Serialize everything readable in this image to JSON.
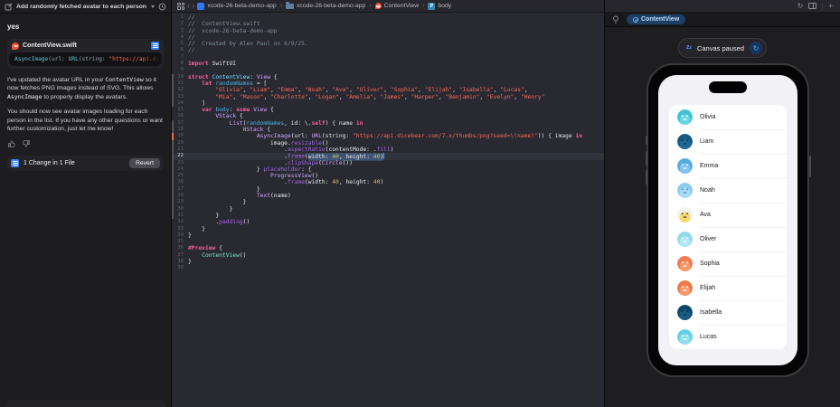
{
  "chat": {
    "header": {
      "title": "Add randomly fetched avatar to each person in ContentVi...",
      "compose_icon": "new-chat",
      "history_icon": "history"
    },
    "user_message": "yes",
    "file_reference": {
      "filename": "ContentView.swift",
      "snippet_segs": [
        [
          "t2",
          "AsyncImage"
        ],
        [
          "t3",
          "(url: "
        ],
        [
          "t2",
          "URL"
        ],
        [
          "t3",
          "(string: "
        ],
        [
          "s2",
          "\"https://api.diceb"
        ]
      ]
    },
    "paragraphs": [
      {
        "segs": [
          [
            "t",
            "I've updated the avatar URL in your "
          ],
          [
            "c",
            "ContentView"
          ],
          [
            "t",
            " so it now fetches PNG images instead of SVG. This allows "
          ],
          [
            "c",
            "AsyncImage"
          ],
          [
            "t",
            " to properly display the avatars."
          ]
        ]
      },
      {
        "segs": [
          [
            "t",
            "You should now see avatar images loading for each person in the list. If you have any other questions or want further customization, just let me know!"
          ]
        ]
      }
    ],
    "changes_bar": {
      "label": "1 Change in 1 File",
      "revert_label": "Revert"
    }
  },
  "editor": {
    "breadcrumbs": [
      {
        "icon": "app",
        "label": "xcode-26-beta-demo-app"
      },
      {
        "icon": "folder",
        "label": "xcode-26-beta-demo-app"
      },
      {
        "icon": "swift",
        "label": "ContentView"
      },
      {
        "icon": "property",
        "label": "body"
      }
    ],
    "code": {
      "lines": [
        {
          "n": 1,
          "s": [
            [
              "cm",
              "//"
            ]
          ]
        },
        {
          "n": 2,
          "s": [
            [
              "cm",
              "//  ContentView.swift"
            ]
          ]
        },
        {
          "n": 3,
          "s": [
            [
              "cm",
              "//  xcode-26-beta-demo-app"
            ]
          ]
        },
        {
          "n": 4,
          "s": [
            [
              "cm",
              "//"
            ]
          ]
        },
        {
          "n": 5,
          "s": [
            [
              "cm",
              "//  Created by Alex Paul on 6/9/25."
            ]
          ]
        },
        {
          "n": 6,
          "s": [
            [
              "cm",
              "//"
            ]
          ]
        },
        {
          "n": 7,
          "s": []
        },
        {
          "n": 8,
          "s": [
            [
              "kw",
              "import"
            ],
            [
              "pl",
              " SwiftUI"
            ]
          ]
        },
        {
          "n": 9,
          "s": []
        },
        {
          "n": 10,
          "chg": "g",
          "s": [
            [
              "kw",
              "struct"
            ],
            [
              "pl",
              " "
            ],
            [
              "pt",
              "ContentView"
            ],
            [
              "pl",
              ": "
            ],
            [
              "ty",
              "View"
            ],
            [
              "pl",
              " {"
            ]
          ]
        },
        {
          "n": 11,
          "chg": "g",
          "s": [
            [
              "pl",
              "    "
            ],
            [
              "kw",
              "let"
            ],
            [
              "pl",
              " "
            ],
            [
              "pv",
              "randomNames"
            ],
            [
              "pl",
              " = ["
            ]
          ]
        },
        {
          "n": 12,
          "chg": "g",
          "s": [
            [
              "pl",
              "        "
            ],
            [
              "st",
              "\"Olivia\""
            ],
            [
              "pl",
              ", "
            ],
            [
              "st",
              "\"Liam\""
            ],
            [
              "pl",
              ", "
            ],
            [
              "st",
              "\"Emma\""
            ],
            [
              "pl",
              ", "
            ],
            [
              "st",
              "\"Noah\""
            ],
            [
              "pl",
              ", "
            ],
            [
              "st",
              "\"Ava\""
            ],
            [
              "pl",
              ", "
            ],
            [
              "st",
              "\"Oliver\""
            ],
            [
              "pl",
              ", "
            ],
            [
              "st",
              "\"Sophia\""
            ],
            [
              "pl",
              ", "
            ],
            [
              "st",
              "\"Elijah\""
            ],
            [
              "pl",
              ", "
            ],
            [
              "st",
              "\"Isabella\""
            ],
            [
              "pl",
              ", "
            ],
            [
              "st",
              "\"Lucas\""
            ],
            [
              "pl",
              ","
            ]
          ]
        },
        {
          "n": 13,
          "chg": "g",
          "s": [
            [
              "pl",
              "        "
            ],
            [
              "st",
              "\"Mia\""
            ],
            [
              "pl",
              ", "
            ],
            [
              "st",
              "\"Mason\""
            ],
            [
              "pl",
              ", "
            ],
            [
              "st",
              "\"Charlotte\""
            ],
            [
              "pl",
              ", "
            ],
            [
              "st",
              "\"Logan\""
            ],
            [
              "pl",
              ", "
            ],
            [
              "st",
              "\"Amelia\""
            ],
            [
              "pl",
              ", "
            ],
            [
              "st",
              "\"James\""
            ],
            [
              "pl",
              ", "
            ],
            [
              "st",
              "\"Harper\""
            ],
            [
              "pl",
              ", "
            ],
            [
              "st",
              "\"Benjamin\""
            ],
            [
              "pl",
              ", "
            ],
            [
              "st",
              "\"Evelyn\""
            ],
            [
              "pl",
              ", "
            ],
            [
              "st",
              "\"Henry\""
            ]
          ]
        },
        {
          "n": 14,
          "chg": "g",
          "s": [
            [
              "pl",
              "    ]"
            ]
          ]
        },
        {
          "n": 15,
          "s": [
            [
              "pl",
              "    "
            ],
            [
              "kw",
              "var"
            ],
            [
              "pl",
              " "
            ],
            [
              "pv",
              "body"
            ],
            [
              "pl",
              ": "
            ],
            [
              "kw",
              "some"
            ],
            [
              "pl",
              " "
            ],
            [
              "ty",
              "View"
            ],
            [
              "pl",
              " {"
            ]
          ]
        },
        {
          "n": 16,
          "s": [
            [
              "pl",
              "        "
            ],
            [
              "ty",
              "VStack"
            ],
            [
              "pl",
              " {"
            ]
          ]
        },
        {
          "n": 17,
          "chg": "g",
          "s": [
            [
              "pl",
              "            "
            ],
            [
              "ty",
              "List"
            ],
            [
              "pl",
              "("
            ],
            [
              "pv",
              "randomNames"
            ],
            [
              "pl",
              ", id: \\."
            ],
            [
              "kw",
              "self"
            ],
            [
              "pl",
              ") { name "
            ],
            [
              "kw",
              "in"
            ]
          ]
        },
        {
          "n": 18,
          "chg": "g",
          "s": [
            [
              "pl",
              "                "
            ],
            [
              "ty",
              "HStack"
            ],
            [
              "pl",
              " {"
            ]
          ]
        },
        {
          "n": 19,
          "chg": "o",
          "s": [
            [
              "pl",
              "                    "
            ],
            [
              "ty",
              "AsyncImage"
            ],
            [
              "pl",
              "(url: "
            ],
            [
              "ty",
              "URL"
            ],
            [
              "pl",
              "(string: "
            ],
            [
              "st",
              "\"https://api.dicebear.com/7.x/thumbs/png?seed=\\(name)\""
            ],
            [
              "pl",
              ")) { image "
            ],
            [
              "kw",
              "in"
            ]
          ]
        },
        {
          "n": 20,
          "chg": "g",
          "s": [
            [
              "pl",
              "                        image."
            ],
            [
              "fn",
              "resizable"
            ],
            [
              "pl",
              "()"
            ]
          ]
        },
        {
          "n": 21,
          "chg": "g",
          "s": [
            [
              "pl",
              "                            ."
            ],
            [
              "fn",
              "aspectRatio"
            ],
            [
              "pl",
              "(contentMode: ."
            ],
            [
              "fn",
              "fill"
            ],
            [
              "pl",
              ")"
            ]
          ]
        },
        {
          "n": 22,
          "chg": "g",
          "cur": true,
          "s": [
            [
              "pl",
              "                            ."
            ],
            [
              "fn",
              "frame"
            ],
            [
              "pl",
              "("
            ],
            [
              "pl sel",
              "width: "
            ],
            [
              "nu sel",
              "40"
            ],
            [
              "pl sel",
              ", height: "
            ],
            [
              "nu sel",
              "40"
            ],
            [
              "pl sel",
              ")"
            ],
            [
              "caret",
              ""
            ]
          ]
        },
        {
          "n": 23,
          "chg": "g",
          "s": [
            [
              "pl",
              "                            ."
            ],
            [
              "fn",
              "clipShape"
            ],
            [
              "pl",
              "("
            ],
            [
              "ty",
              "Circle"
            ],
            [
              "pl",
              "())"
            ]
          ]
        },
        {
          "n": 24,
          "chg": "g",
          "s": [
            [
              "pl",
              "                    } "
            ],
            [
              "fn",
              "placeholder"
            ],
            [
              "pl",
              ": {"
            ]
          ]
        },
        {
          "n": 25,
          "chg": "g",
          "s": [
            [
              "pl",
              "                        "
            ],
            [
              "ty",
              "ProgressView"
            ],
            [
              "pl",
              "()"
            ]
          ]
        },
        {
          "n": 26,
          "chg": "g",
          "s": [
            [
              "pl",
              "                            ."
            ],
            [
              "fn",
              "frame"
            ],
            [
              "pl",
              "(width: "
            ],
            [
              "nu",
              "40"
            ],
            [
              "pl",
              ", height: "
            ],
            [
              "nu",
              "40"
            ],
            [
              "pl",
              ")"
            ]
          ]
        },
        {
          "n": 27,
          "chg": "g",
          "s": [
            [
              "pl",
              "                    }"
            ]
          ]
        },
        {
          "n": 28,
          "chg": "g",
          "s": [
            [
              "pl",
              "                    "
            ],
            [
              "ty",
              "Text"
            ],
            [
              "pl",
              "(name)"
            ]
          ]
        },
        {
          "n": 29,
          "chg": "g",
          "s": [
            [
              "pl",
              "                }"
            ]
          ]
        },
        {
          "n": 30,
          "chg": "g",
          "s": [
            [
              "pl",
              "            }"
            ]
          ]
        },
        {
          "n": 31,
          "chg": "g",
          "s": [
            [
              "pl",
              "        }"
            ]
          ]
        },
        {
          "n": 32,
          "s": [
            [
              "pl",
              "        ."
            ],
            [
              "fn",
              "padding"
            ],
            [
              "pl",
              "()"
            ]
          ]
        },
        {
          "n": 33,
          "s": [
            [
              "pl",
              "    }"
            ]
          ]
        },
        {
          "n": 34,
          "s": [
            [
              "pl",
              "}"
            ]
          ]
        },
        {
          "n": 35,
          "s": []
        },
        {
          "n": 36,
          "s": [
            [
              "kw",
              "#Preview"
            ],
            [
              "pl",
              " {"
            ]
          ]
        },
        {
          "n": 37,
          "s": [
            [
              "pl",
              "    "
            ],
            [
              "pu",
              "ContentView"
            ],
            [
              "pl",
              "()"
            ]
          ]
        },
        {
          "n": 38,
          "s": [
            [
              "pl",
              "}"
            ]
          ]
        },
        {
          "n": 39,
          "s": []
        }
      ]
    }
  },
  "preview": {
    "tab_label": "ContentView",
    "paused_label": "Canvas paused",
    "colors": {
      "accent": "#4a9eff",
      "tab_bg": "#1d3f63"
    },
    "people": [
      {
        "name": "Olivia",
        "bg": "#3ec3d6",
        "blob": "#6ad6e1",
        "feat": "#ffffff"
      },
      {
        "name": "Liam",
        "bg": "#155880",
        "blob": "#1e6a96",
        "feat": "#0b3c5c"
      },
      {
        "name": "Emma",
        "bg": "#57abe3",
        "blob": "#7ec2ee",
        "feat": "#ffffff"
      },
      {
        "name": "Noah",
        "bg": "#8acdf1",
        "blob": "#a9ddf6",
        "feat": "#5b8fae"
      },
      {
        "name": "Ava",
        "bg": "#eff1ec",
        "blob": "#ffd869",
        "feat": "#4a4a4a"
      },
      {
        "name": "Oliver",
        "bg": "#93d9ec",
        "blob": "#b3e6f3",
        "feat": "#ffffff"
      },
      {
        "name": "Sophia",
        "bg": "#f07b4d",
        "blob": "#f49a67",
        "feat": "#ffffff"
      },
      {
        "name": "Elijah",
        "bg": "#f0794a",
        "blob": "#f49a6c",
        "feat": "#ffffff"
      },
      {
        "name": "Isabella",
        "bg": "#10486c",
        "blob": "#1a5c85",
        "feat": "#08344f"
      },
      {
        "name": "Lucas",
        "bg": "#63d2e9",
        "blob": "#8ee0f0",
        "feat": "#ffffff"
      }
    ]
  }
}
